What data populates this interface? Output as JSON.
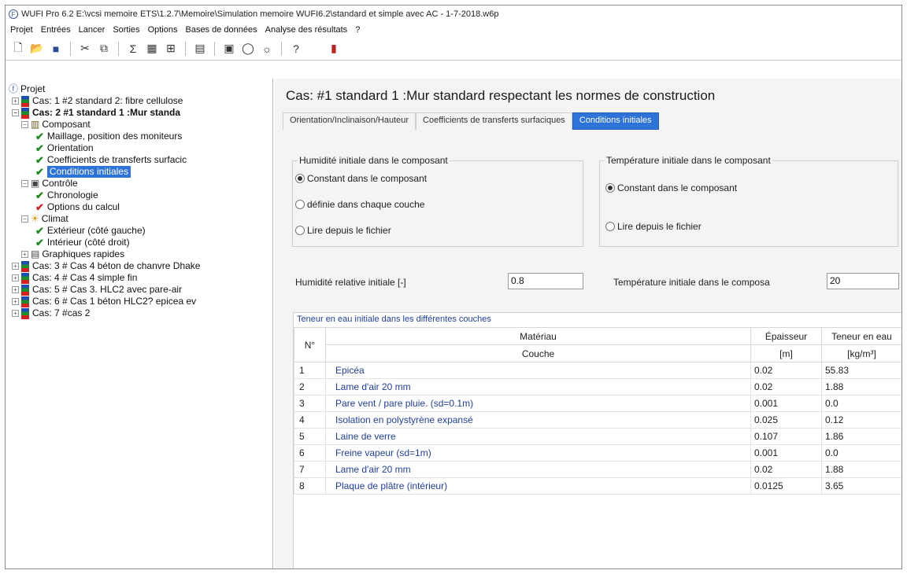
{
  "window": {
    "title": "WUFI Pro 6.2   E:\\vcsi memoire ETS\\1.2.7\\Memoire\\Simulation memoire WUFI6.2\\standard et simple avec AC - 1-7-2018.w6p"
  },
  "menu": [
    "Projet",
    "Entrées",
    "Lancer",
    "Sorties",
    "Options",
    "Bases de données",
    "Analyse des résultats",
    "?"
  ],
  "toolbar_icons": [
    "new-file-icon",
    "open-folder-icon",
    "save-icon",
    "cut-icon",
    "copy-icon",
    "paste-icon",
    "calc-icon",
    "grid-icon",
    "monitor-icon",
    "chart-icon",
    "image-icon",
    "circle-icon",
    "climate-icon",
    "help-icon",
    "exit-icon"
  ],
  "tree": {
    "root": "Projet",
    "case1": "Cas: 1 #2 standard 2: fibre cellulose",
    "case2": "Cas: 2 #1 standard  1 :Mur standa",
    "composant": "Composant",
    "maillage": "Maillage, position des moniteurs",
    "orientation": "Orientation",
    "coefficients": "Coefficients de transferts surfacic",
    "conditions": "Conditions initiales",
    "controle": "Contrôle",
    "chronologie": "Chronologie",
    "options_calcul": "Options du calcul",
    "climat": "Climat",
    "exterieur": "Extérieur (côté gauche)",
    "interieur": "Intérieur (côté droit)",
    "graphiques": "Graphiques rapides",
    "case3": "Cas: 3 # Cas 4 béton de chanvre Dhake",
    "case4": "Cas: 4 # Cas 4 simple fin",
    "case5": "Cas: 5 # Cas 3. HLC2 avec pare-air",
    "case6": "Cas: 6 # Cas 1 béton HLC2? epicea ev",
    "case7": "Cas: 7 #cas 2"
  },
  "main": {
    "case_title": "Cas:  #1 standard  1 :Mur standard respectant les normes de construction",
    "tabs": [
      "Orientation/Inclinaison/Hauteur",
      "Coefficients de transferts surfaciques",
      "Conditions initiales"
    ],
    "humidity_group": {
      "legend": "Humidité initiale dans le composant",
      "options": [
        "Constant dans le composant",
        "définie dans chaque couche",
        "Lire depuis le fichier"
      ]
    },
    "temperature_group": {
      "legend": "Température initiale dans le composant",
      "options": [
        "Constant dans le composant",
        "Lire depuis le fichier"
      ]
    },
    "rh_label": "Humidité relative initiale [-]",
    "rh_value": "0.8",
    "temp_label": "Température initiale dans le composa",
    "temp_value": "20",
    "table": {
      "caption": "Teneur en eau initiale dans les différentes couches",
      "header": {
        "n": "N°",
        "materiau": "Matériau",
        "couche": "Couche",
        "epaisseur": "Épaisseur",
        "epaisseur_unit": "[m]",
        "teneur": "Teneur en eau",
        "teneur_unit": "[kg/m³]"
      },
      "rows": [
        {
          "n": "1",
          "material": "Epicéa",
          "thickness": "0.02",
          "water": "55.83"
        },
        {
          "n": "2",
          "material": "Lame d'air 20 mm",
          "thickness": "0.02",
          "water": "1.88"
        },
        {
          "n": "3",
          "material": "Pare vent / pare pluie. (sd=0.1m)",
          "thickness": "0.001",
          "water": "0.0"
        },
        {
          "n": "4",
          "material": "Isolation en polystyrène expansé",
          "thickness": "0.025",
          "water": "0.12"
        },
        {
          "n": "5",
          "material": "Laine de verre",
          "thickness": "0.107",
          "water": "1.86"
        },
        {
          "n": "6",
          "material": "Freine vapeur (sd=1m)",
          "thickness": "0.001",
          "water": "0.0"
        },
        {
          "n": "7",
          "material": "Lame d'air 20 mm",
          "thickness": "0.02",
          "water": "1.88"
        },
        {
          "n": "8",
          "material": "Plaque de plâtre (intérieur)",
          "thickness": "0.0125",
          "water": "3.65"
        }
      ]
    }
  }
}
